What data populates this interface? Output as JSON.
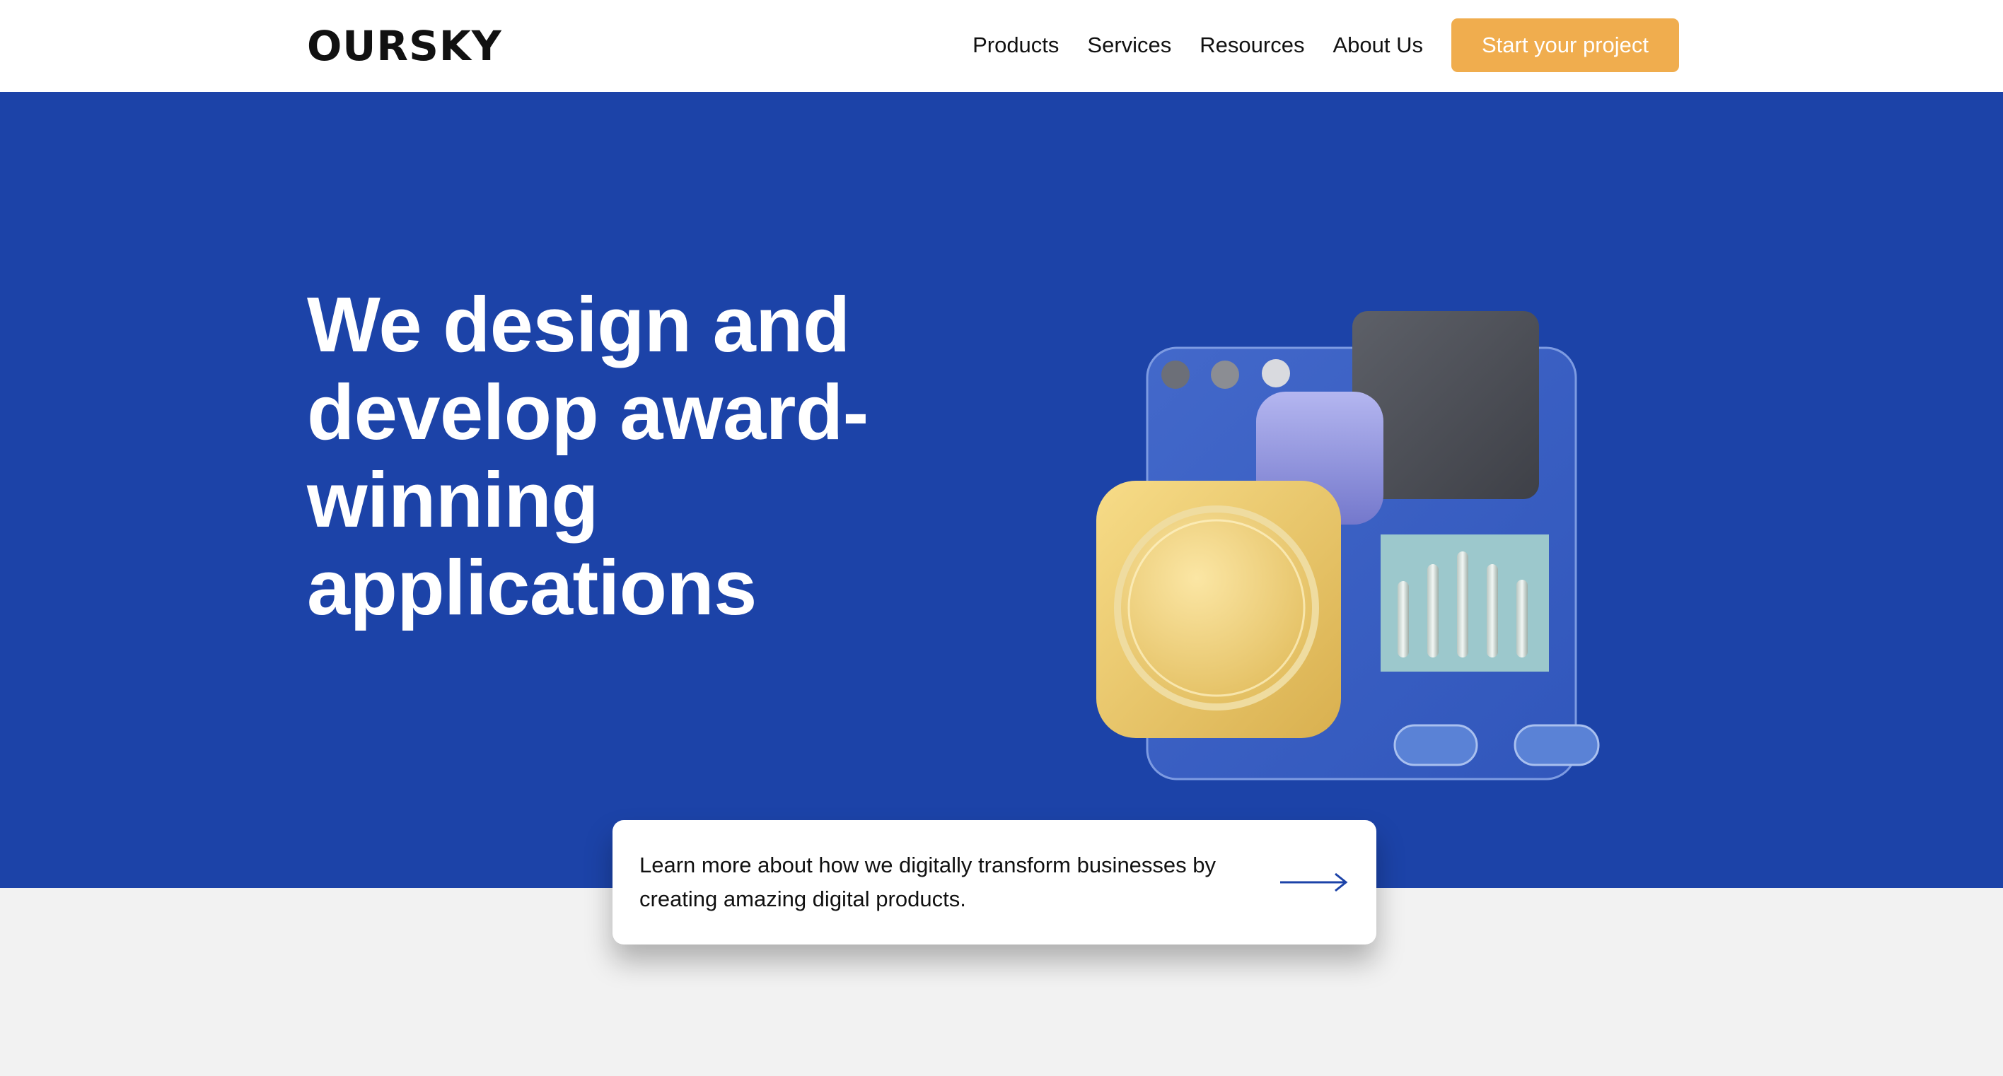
{
  "header": {
    "logo": "OURSKY",
    "nav": [
      "Products",
      "Services",
      "Resources",
      "About Us"
    ],
    "cta_label": "Start your project"
  },
  "hero": {
    "title": "We design and develop award-winning applications"
  },
  "card": {
    "text": "Learn more about how we digitally transform businesses by creating amazing digital products.",
    "arrow_icon": "arrow-right-icon"
  },
  "colors": {
    "hero_bg": "#1c43a8",
    "cta_bg": "#f0ad4e",
    "page_bg": "#f2f2f2",
    "accent_blue": "#1c43a8"
  }
}
